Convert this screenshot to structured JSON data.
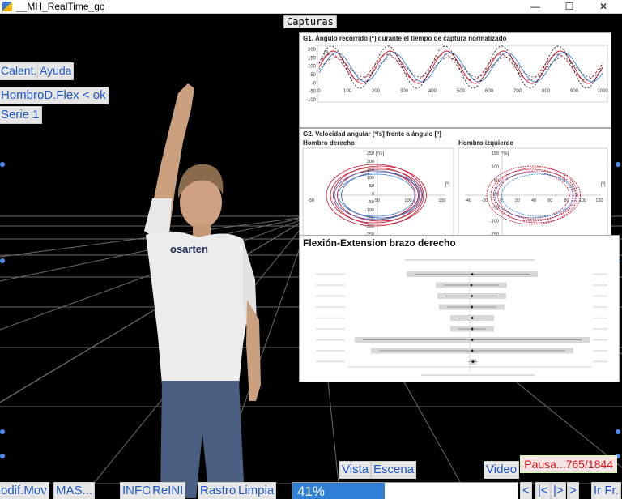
{
  "window": {
    "title": "__MH_RealTime_go",
    "minimize": "—",
    "maximize": "☐",
    "close": "✕"
  },
  "left_buttons": {
    "calent": "Calent.",
    "ayuda": "Ayuda",
    "exercise": "HombroD.Flex < ok",
    "serie": "Serie 1"
  },
  "capturas": {
    "label": "Capturas",
    "g1": {
      "title": "G1. Ángulo recorrido [º] durante el tiempo de captura normalizado",
      "unit": "[º]",
      "yticks": [
        "200",
        "150",
        "100",
        "50",
        "0",
        "-50",
        "-100"
      ],
      "xticks": [
        "0",
        "100",
        "200",
        "300",
        "400",
        "500",
        "600",
        "700",
        "800",
        "900",
        "1000"
      ]
    },
    "g2": {
      "title": "G2. Velocidad angular [º/s] frente a ángulo [º]",
      "right_label": "Hombro derecho",
      "left_label": "Hombro izquierdo",
      "unit_y": "[º/s]",
      "unit_x": "[º]",
      "right_yticks": [
        "250",
        "200",
        "150",
        "100",
        "50",
        "0",
        "-50",
        "-100",
        "-150",
        "-200",
        "-250"
      ],
      "right_xticks": [
        "-50",
        "50",
        "100",
        "150"
      ],
      "left_yticks": [
        "150",
        "100",
        "50",
        "0",
        "-50",
        "-100",
        "-150"
      ],
      "left_xticks": [
        "-40",
        "-20",
        "0",
        "20",
        "40",
        "60",
        "80",
        "100",
        "120"
      ]
    },
    "flexion": {
      "title": "Flexión-Extension brazo derecho"
    }
  },
  "status": {
    "pausa": "Pausa...765/1844"
  },
  "progress": {
    "percent": 41,
    "label": "41%"
  },
  "bottom_buttons": {
    "vista": "Vista",
    "escena": "Escena",
    "video": "Video",
    "modif": "odif.Mov",
    "mas": "MAS...",
    "info": "INFO",
    "reini": "ReINI",
    "rastro": "Rastro",
    "limpia": "Limpia",
    "first": "<",
    "prev": "|<",
    "next": "|>",
    "last": ">",
    "irfr": "Ir Fr."
  },
  "colors": {
    "accent": "#1f57c8",
    "progress": "#2e7fd6",
    "pause": "#d51515",
    "red_trace": "#c0102b",
    "blue_trace": "#3b7fd0"
  }
}
